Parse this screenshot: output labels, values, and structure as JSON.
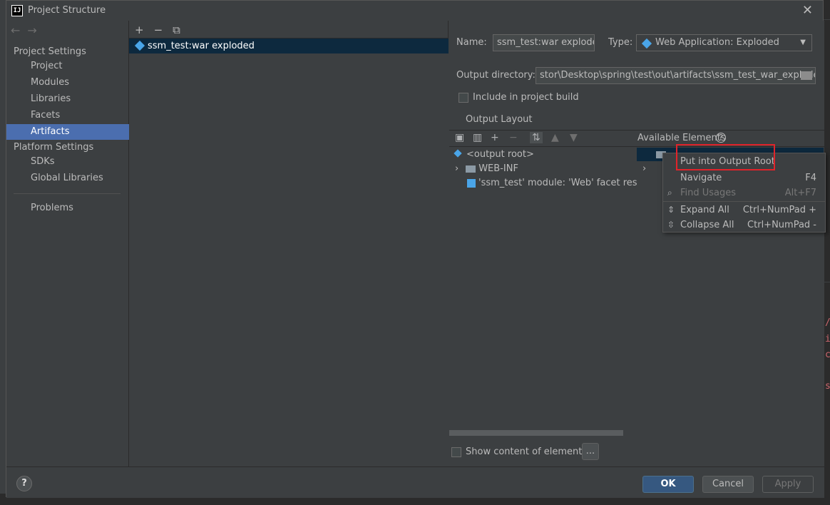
{
  "window": {
    "title": "Project Structure",
    "close_glyph": "✕",
    "app_icon_text": "IJ"
  },
  "nav": {
    "back_glyph": "←",
    "forward_glyph": "→",
    "project_settings_label": "Project Settings",
    "project_settings_items": [
      "Project",
      "Modules",
      "Libraries",
      "Facets",
      "Artifacts"
    ],
    "selected_item": "Artifacts",
    "platform_settings_label": "Platform Settings",
    "platform_settings_items": [
      "SDKs",
      "Global Libraries"
    ],
    "problems_label": "Problems"
  },
  "artifacts": {
    "toolbar": {
      "add": "+",
      "remove": "−",
      "copy": "⧉"
    },
    "items": [
      "ssm_test:war exploded"
    ]
  },
  "details": {
    "name_label": "Name:",
    "name_value": "ssm_test:war exploded",
    "type_label": "Type:",
    "type_value": "Web Application: Exploded",
    "output_dir_label": "Output directory:",
    "output_dir_value": "stor\\Desktop\\spring\\test\\out\\artifacts\\ssm_test_war_exploded",
    "include_label": "Include in project build",
    "output_layout_tab": "Output Layout",
    "available_elements_label": "Available Elements",
    "tree": [
      {
        "label": "<output root>",
        "icon": "diamond-icon"
      },
      {
        "label": "WEB-INF",
        "icon": "folder-icon"
      },
      {
        "label": "'ssm_test' module: 'Web' facet resources",
        "icon": "web-facet-icon"
      }
    ],
    "show_content_label": "Show content of elements",
    "ellipsis_label": "..."
  },
  "context_menu": {
    "items": [
      {
        "label": "Put into Output Root",
        "shortcut": "",
        "enabled": true
      },
      {
        "label": "Navigate",
        "shortcut": "F4",
        "enabled": true
      },
      {
        "label": "Find Usages",
        "shortcut": "Alt+F7",
        "enabled": false
      },
      {
        "label": "Expand All",
        "shortcut": "Ctrl+NumPad +",
        "enabled": true
      },
      {
        "label": "Collapse All",
        "shortcut": "Ctrl+NumPad -",
        "enabled": true
      }
    ]
  },
  "buttons": {
    "help": "?",
    "ok": "OK",
    "cancel": "Cancel",
    "apply": "Apply"
  },
  "colors": {
    "selection": "#4b6eaf",
    "list_selection": "#0d293e",
    "highlight_box": "#e0232a",
    "primary_button": "#365880"
  }
}
